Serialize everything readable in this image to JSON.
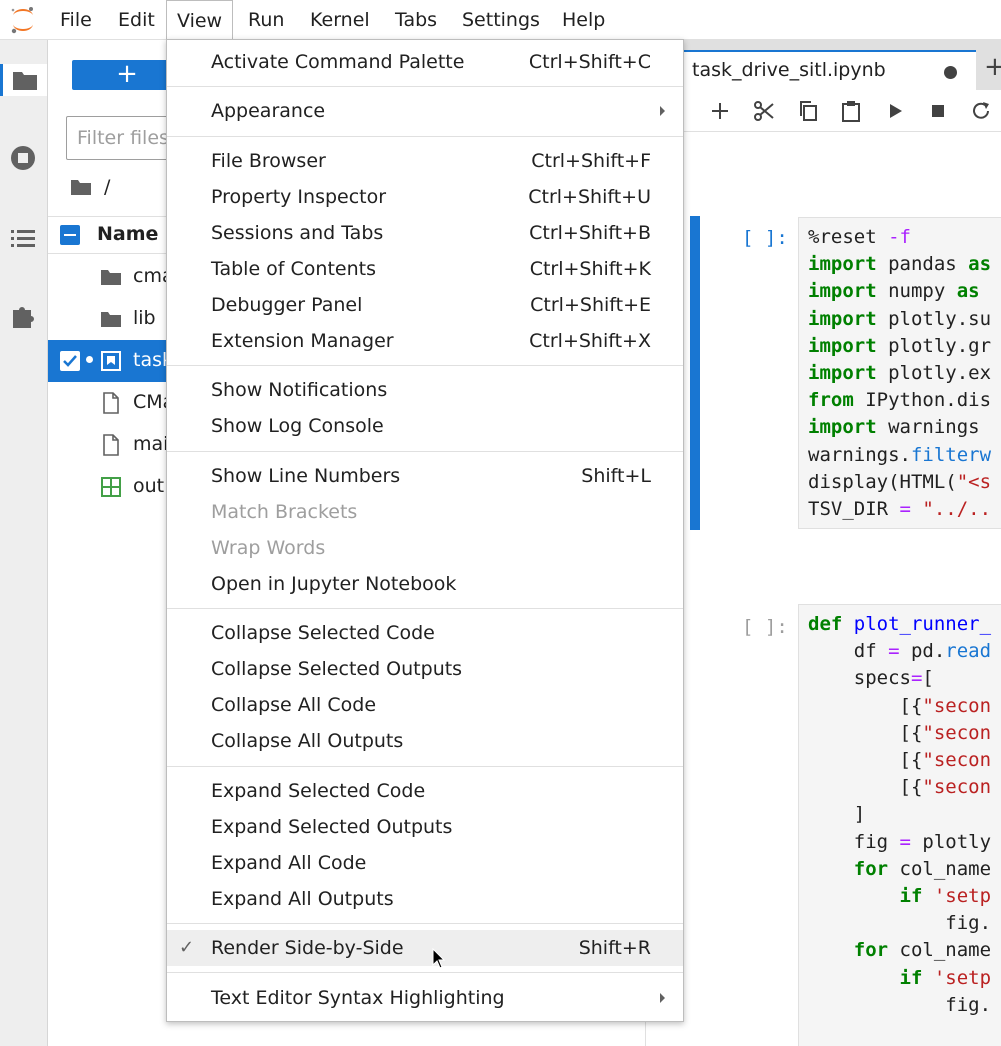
{
  "menubar": {
    "items": [
      "File",
      "Edit",
      "View",
      "Run",
      "Kernel",
      "Tabs",
      "Settings",
      "Help"
    ],
    "active": "View"
  },
  "filebrowser": {
    "new_label": "+",
    "filter_placeholder": "Filter files",
    "breadcrumb": "/",
    "header_name": "Name",
    "files": [
      {
        "name": "cma",
        "type": "folder"
      },
      {
        "name": "lib",
        "type": "folder"
      },
      {
        "name": "task",
        "type": "notebook",
        "selected": true
      },
      {
        "name": "CMa",
        "type": "file"
      },
      {
        "name": "mai",
        "type": "file"
      },
      {
        "name": "out",
        "type": "spreadsheet"
      }
    ]
  },
  "notebook": {
    "tab_label": "task_drive_sitl.ipynb",
    "add_tab": "+",
    "cell1_prompt": "[ ]:",
    "cell2_prompt": "[ ]:"
  },
  "view_menu": {
    "items": [
      {
        "label": "Activate Command Palette",
        "shortcut": "Ctrl+Shift+C"
      },
      {
        "label": "Appearance",
        "submenu": true
      },
      {
        "label": "File Browser",
        "shortcut": "Ctrl+Shift+F"
      },
      {
        "label": "Property Inspector",
        "shortcut": "Ctrl+Shift+U"
      },
      {
        "label": "Sessions and Tabs",
        "shortcut": "Ctrl+Shift+B"
      },
      {
        "label": "Table of Contents",
        "shortcut": "Ctrl+Shift+K"
      },
      {
        "label": "Debugger Panel",
        "shortcut": "Ctrl+Shift+E"
      },
      {
        "label": "Extension Manager",
        "shortcut": "Ctrl+Shift+X"
      },
      {
        "label": "Show Notifications"
      },
      {
        "label": "Show Log Console"
      },
      {
        "label": "Show Line Numbers",
        "shortcut": "Shift+L"
      },
      {
        "label": "Match Brackets",
        "disabled": true
      },
      {
        "label": "Wrap Words",
        "disabled": true
      },
      {
        "label": "Open in Jupyter Notebook"
      },
      {
        "label": "Collapse Selected Code"
      },
      {
        "label": "Collapse Selected Outputs"
      },
      {
        "label": "Collapse All Code"
      },
      {
        "label": "Collapse All Outputs"
      },
      {
        "label": "Expand Selected Code"
      },
      {
        "label": "Expand Selected Outputs"
      },
      {
        "label": "Expand All Code"
      },
      {
        "label": "Expand All Outputs"
      },
      {
        "label": "Render Side-by-Side",
        "shortcut": "Shift+R",
        "checked": true,
        "hovered": true
      },
      {
        "label": "Text Editor Syntax Highlighting",
        "submenu": true
      }
    ]
  },
  "colors": {
    "accent": "#1976d2",
    "menu_hover": "#eeeeee",
    "disabled_text": "#9e9e9e"
  }
}
